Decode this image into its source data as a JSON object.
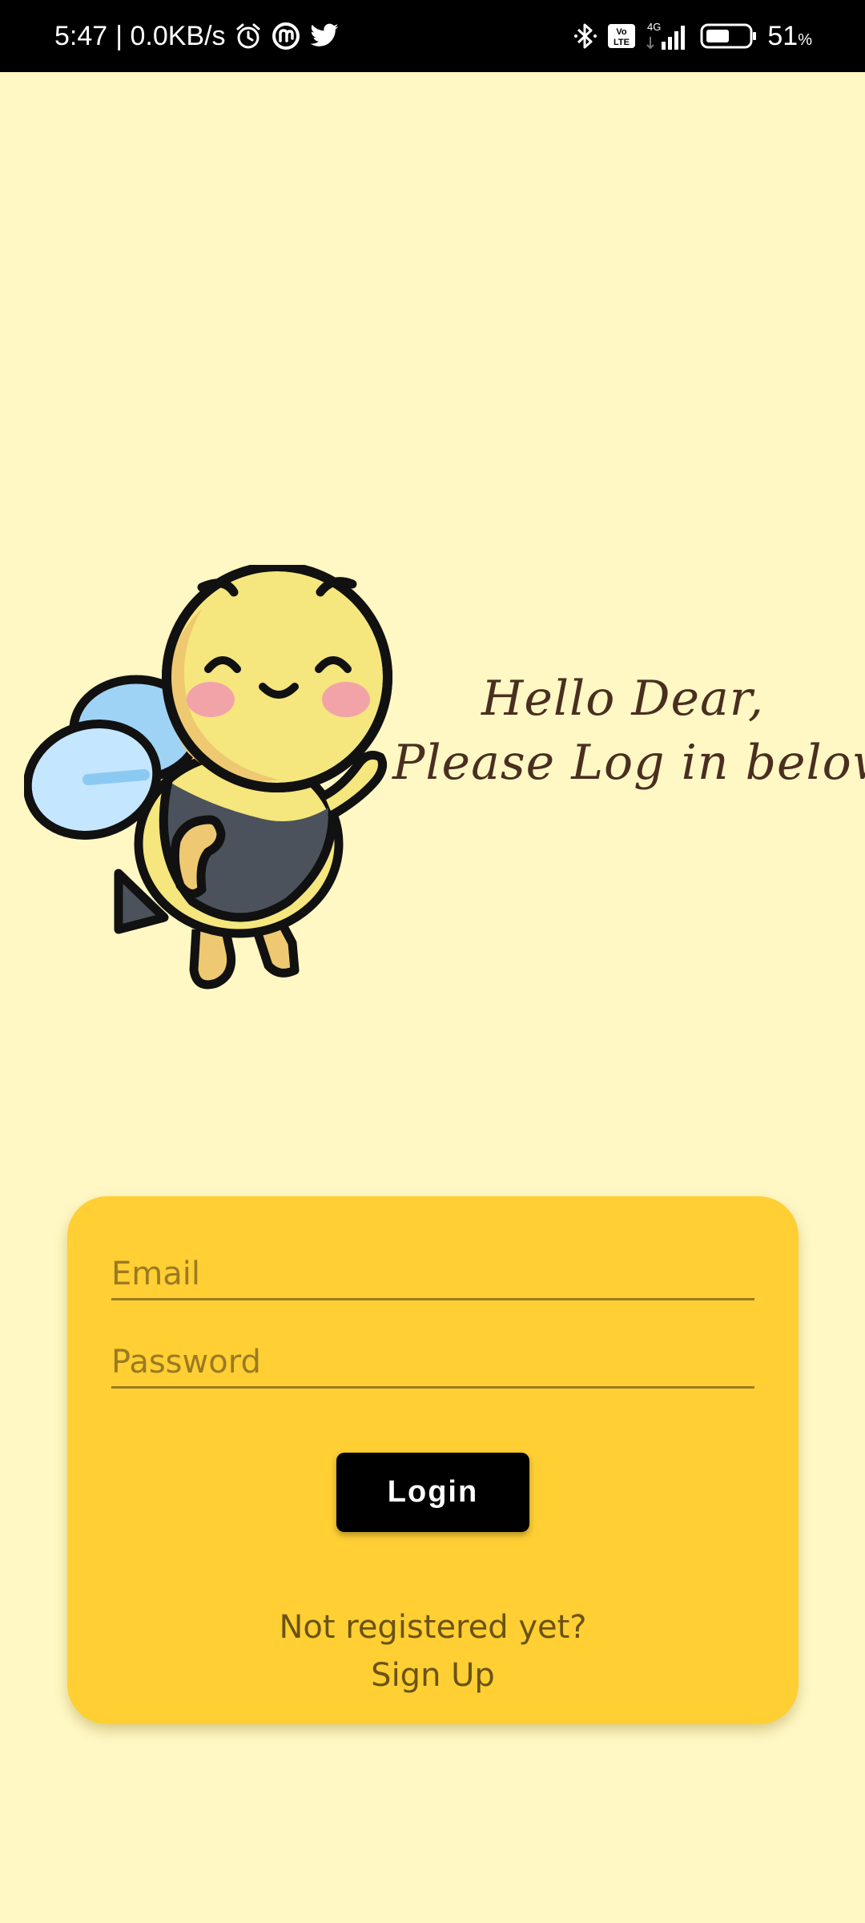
{
  "status_bar": {
    "time": "5:47",
    "speed": "| 0.0KB/s",
    "icons": [
      "alarm-icon",
      "notification-app-icon",
      "twitter-icon",
      "bluetooth-icon",
      "volte-icon",
      "signal-4g-icon",
      "battery-icon"
    ],
    "network_label": "4G",
    "volte_label": "Vo LTE",
    "battery": "51",
    "battery_unit": "%"
  },
  "greeting": {
    "line1": "Hello Dear,",
    "line2": "Please Log in below"
  },
  "form": {
    "email_placeholder": "Email",
    "password_placeholder": "Password",
    "login_label": "Login",
    "signup_prompt": "Not registered yet?",
    "signup_label": "Sign Up"
  },
  "colors": {
    "background": "#fff8c4",
    "card": "#ffcf33",
    "button": "#000000",
    "greeting_text": "#4a2e20",
    "field_text": "#9a7a23"
  }
}
